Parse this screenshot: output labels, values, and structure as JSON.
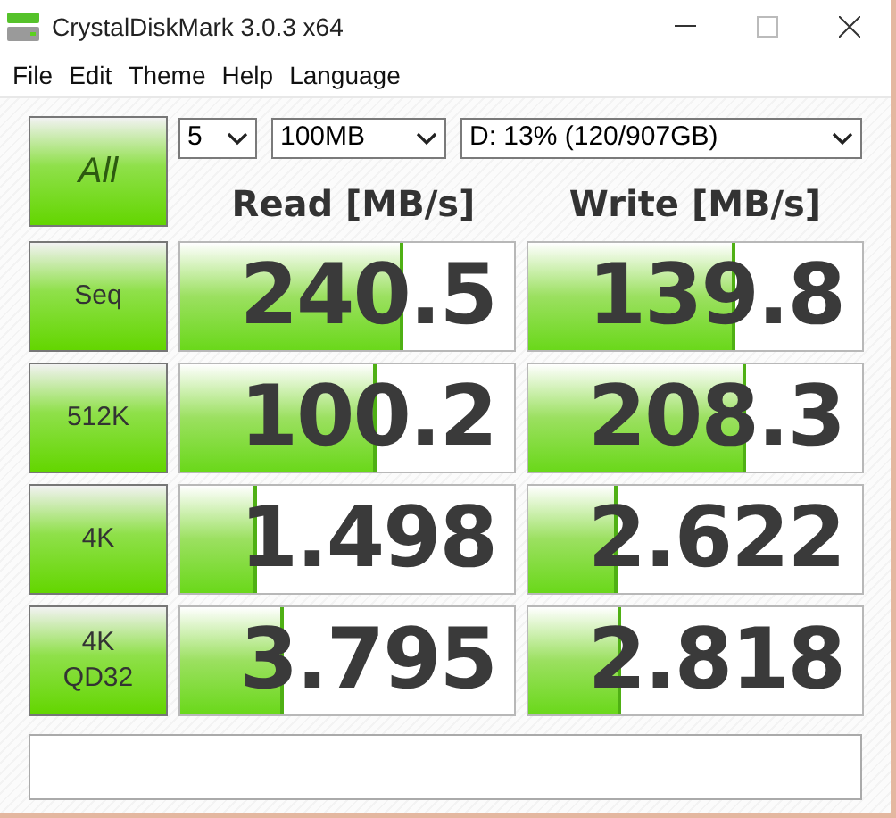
{
  "window": {
    "title": "CrystalDiskMark 3.0.3 x64"
  },
  "menu": [
    "File",
    "Edit",
    "Theme",
    "Help",
    "Language"
  ],
  "all_button": {
    "label": "All"
  },
  "selects": [
    {
      "value": "5"
    },
    {
      "value": "100MB"
    },
    {
      "value": "D: 13% (120/907GB)"
    }
  ],
  "headers": {
    "read": "Read [MB/s]",
    "write": "Write [MB/s]"
  },
  "rows": [
    {
      "label": [
        "Seq"
      ],
      "read": {
        "value": "240.5",
        "level": 0.67
      },
      "write": {
        "value": "139.8",
        "level": 0.62
      }
    },
    {
      "label": [
        "512K"
      ],
      "read": {
        "value": "100.2",
        "level": 0.59
      },
      "write": {
        "value": "208.3",
        "level": 0.65
      }
    },
    {
      "label": [
        "4K"
      ],
      "read": {
        "value": "1.498",
        "level": 0.23
      },
      "write": {
        "value": "2.622",
        "level": 0.27
      }
    },
    {
      "label": [
        "4K",
        "QD32"
      ],
      "read": {
        "value": "3.795",
        "level": 0.31
      },
      "write": {
        "value": "2.818",
        "level": 0.28
      }
    }
  ]
}
